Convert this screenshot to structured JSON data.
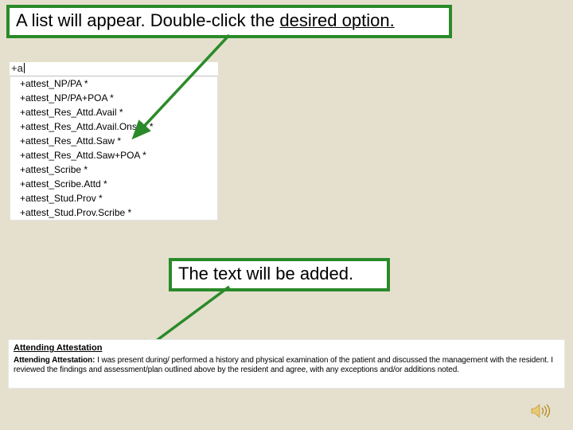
{
  "callouts": {
    "top_prefix": "A list will appear.  Double-click the ",
    "top_underlined": "desired option.",
    "mid": "The text will be added."
  },
  "autocomplete": {
    "typed": "+a",
    "items": [
      "+attest_NP/PA *",
      "+attest_NP/PA+POA *",
      "+attest_Res_Attd.Avail *",
      "+attest_Res_Attd.Avail.Onsite *",
      "+attest_Res_Attd.Saw *",
      "+attest_Res_Attd.Saw+POA *",
      "+attest_Scribe *",
      "+attest_Scribe.Attd *",
      "+attest_Stud.Prov *",
      "+attest_Stud.Prov.Scribe *"
    ]
  },
  "attestation": {
    "heading": "Attending Attestation",
    "body_label": "Attending Attestation:",
    "body_text": " I was present during/ performed a history and physical examination of the patient and discussed the management with the resident. I reviewed the findings and assessment/plan outlined above by the resident and agree, with any exceptions and/or additions noted."
  },
  "icons": {
    "sound": "sound-icon"
  },
  "colors": {
    "slide_bg": "#e5e0cd",
    "callout_border": "#2a8a2a",
    "arrow": "#2a8a2a"
  }
}
